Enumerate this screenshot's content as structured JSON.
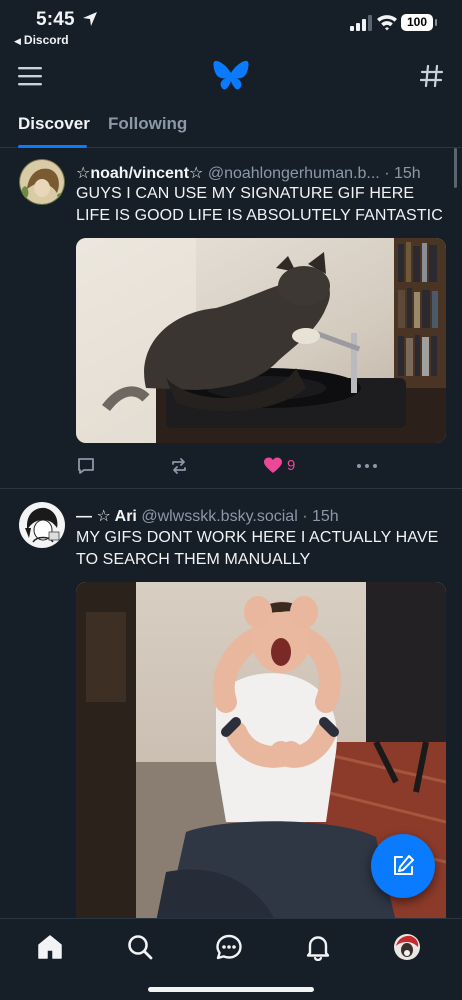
{
  "status_bar": {
    "time": "5:45",
    "back_app": "Discord",
    "battery": "100"
  },
  "header": {
    "menu_icon": "hamburger-icon",
    "logo": "butterfly-logo",
    "feeds_icon": "hash-icon"
  },
  "tabs": [
    {
      "label": "Discover",
      "active": true
    },
    {
      "label": "Following",
      "active": false
    }
  ],
  "posts": [
    {
      "display_name": "☆noah/vincent☆",
      "handle": "@noahlongerhuman.b...",
      "time": "15h",
      "text": "GUYS I CAN USE MY SIGNATURE GIF HERE LIFE IS GOOD LIFE IS ABSOLUTELY FANTASTIC",
      "media_alt": "cat on a record turntable gif",
      "likes": "9"
    },
    {
      "display_name": "— ☆ Ari",
      "handle": "@wlwsskk.bsky.social",
      "time": "15h",
      "text": "MY GIFS DONT WORK HERE I ACTUALLY HAVE TO SEARCH THEM MANUALLY",
      "media_alt": "person holding head screaming gif"
    }
  ],
  "bottom_nav": [
    "home-icon",
    "search-icon",
    "chat-icon",
    "bell-icon",
    "profile-avatar"
  ],
  "colors": {
    "background": "#161e27",
    "accent": "#0a7aff",
    "like": "#ec4899",
    "muted": "#8b98a8"
  }
}
